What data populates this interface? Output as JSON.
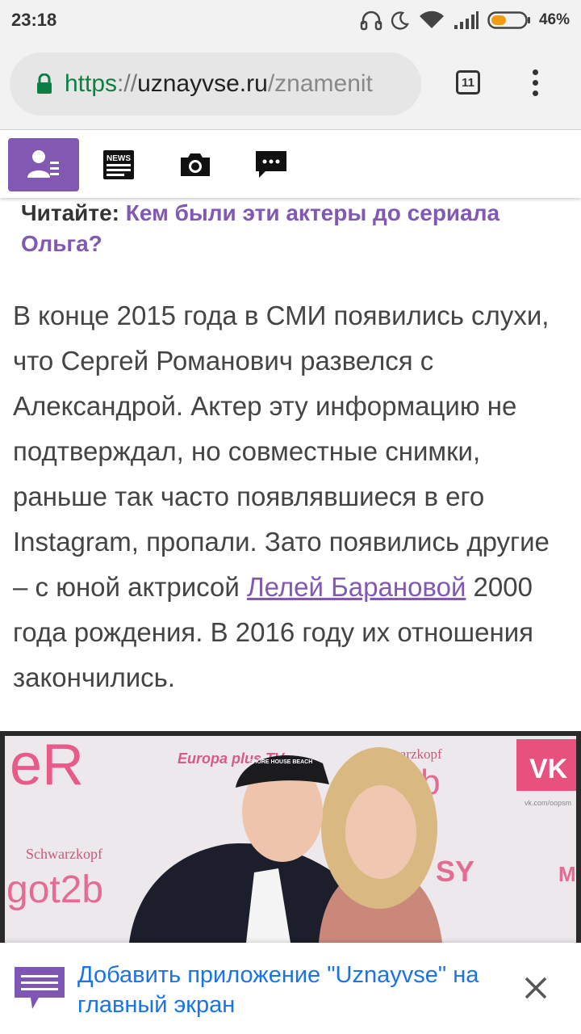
{
  "status_bar": {
    "time": "23:18",
    "battery_percent": "46%",
    "battery_level": 0.46,
    "icons": [
      "headphones-icon",
      "moon-icon",
      "wifi-icon",
      "signal-icon",
      "battery-icon"
    ]
  },
  "browser": {
    "url_scheme": "https",
    "url_sep": "://",
    "url_host": "uznayvse.ru",
    "url_path": "/znamenit",
    "tab_count": "11",
    "colors": {
      "secure": "#0b8043",
      "toolbar": "#f2f2f2"
    }
  },
  "site_nav": {
    "items": [
      {
        "icon": "user-profile-icon",
        "active": true
      },
      {
        "icon": "news-icon",
        "icon_text": "NEWS",
        "active": false
      },
      {
        "icon": "camera-icon",
        "active": false
      },
      {
        "icon": "comments-icon",
        "active": false
      }
    ],
    "accent": "#8159b3"
  },
  "read_also": {
    "label": "Читайте:",
    "link": "Кем были эти актеры до сериала Ольга?"
  },
  "article": {
    "text_before": "В конце 2015 года в СМИ появились слухи, что Сергей Романович развелся с Александрой. Актер эту информацию не подтверждал, но совместные снимки, раньше так часто появлявшиеся в его Instagram, пропали. Зато появились другие – с юной актрисой ",
    "link": "Лелей Барановой",
    "text_after": " 2000 года рождения. В 2016 году их отношения закончились."
  },
  "photo": {
    "backdrop_texts": [
      "eR",
      "Europa plus TV",
      "Schwarzkopf",
      "ot2b",
      "VK",
      "vk.com/oopsm",
      "Schwarzkopf",
      "got2b",
      "SY",
      "M"
    ],
    "cap_text": "SHORE HOUSE BEACH"
  },
  "install_banner": {
    "text": "Добавить приложение \"Uznayvse\" на главный экран",
    "icon": "chat-bubble-icon",
    "close_icon": "close-icon"
  }
}
